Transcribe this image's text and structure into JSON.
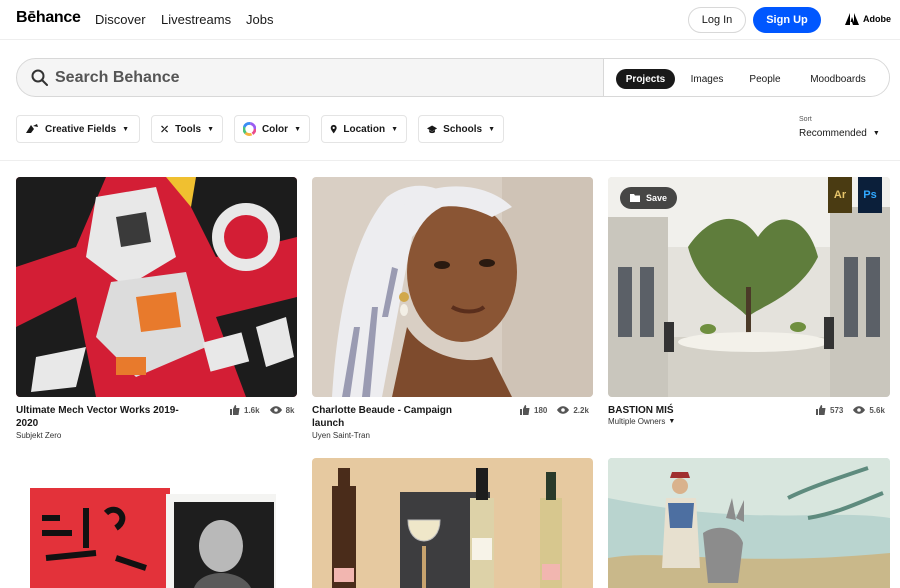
{
  "nav": {
    "logo": "Bēhance",
    "links": [
      "Discover",
      "Livestreams",
      "Jobs"
    ],
    "login": "Log In",
    "signup": "Sign Up",
    "adobe": "Adobe"
  },
  "search": {
    "placeholder": "Search Behance",
    "tabs": [
      "Projects",
      "Images",
      "People",
      "Moodboards"
    ],
    "active_tab": "Projects"
  },
  "filters": {
    "items": [
      "Creative Fields",
      "Tools",
      "Color",
      "Location",
      "Schools"
    ],
    "sort_label": "Sort",
    "sort_value": "Recommended"
  },
  "colors": {
    "brand_blue": "#0057ff",
    "dark": "#191919"
  },
  "projects": [
    {
      "title_line1": "Ultimate Mech Vector Works 2019-",
      "title_line2": "2020",
      "owner": "Subjekt Zero",
      "likes": "1.6k",
      "views": "8k",
      "image": "mech robot illustration"
    },
    {
      "title_line1": "Charlotte Beaude - Campaign",
      "title_line2": "launch",
      "owner": "Uyen Saint-Tran",
      "likes": "180",
      "views": "2.2k",
      "image": "portrait with headscarf"
    },
    {
      "title_line1": "BASTION MIŚ",
      "title_line2": "",
      "owner": "Multiple Owners",
      "likes": "573",
      "views": "5.6k",
      "image": "architecture courtyard",
      "save_label": "Save",
      "tool_badges": [
        "Ar",
        "Ps"
      ]
    },
    {
      "image": "book cover typography"
    },
    {
      "image": "wine bottles still life"
    },
    {
      "image": "illustrated traveler with donkey"
    }
  ]
}
